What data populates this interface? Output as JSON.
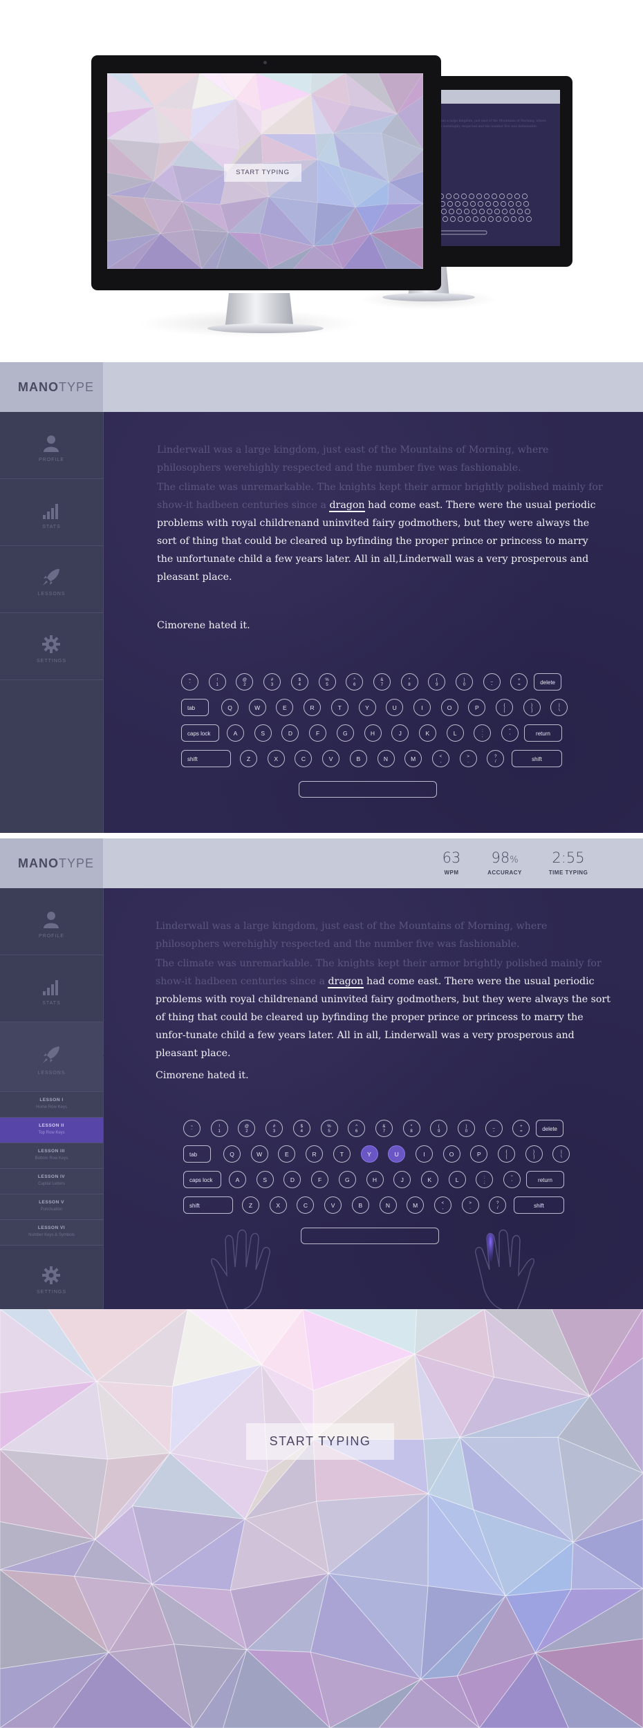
{
  "mockup": {
    "start_button_label": "START TYPING"
  },
  "app": {
    "logo_bold": "MANO",
    "logo_light": "TYPE",
    "sidebar": {
      "profile": "PROFILE",
      "stats": "STATS",
      "lessons": "LESSONS",
      "settings": "SETTINGS"
    },
    "text": {
      "p1": "Linderwall was a large kingdom, just east of the Mountains of Morning, where philosophers werehighly respected and the number five was fashionable.",
      "p2_typed": "The climate was unremarkable. The knights kept their armor brightly polished mainly for show-it hadbeen centuries since a ",
      "p2_current_word": "dragon",
      "p2_rest_v1": " had come east. There were the usual periodic problems with royal childrenand uninvited fairy godmothers, but they were always the sort of thing that could be cleared up byfinding the proper prince or princess to marry the unfortunate child a few years later. All in all,Linderwall was a very prosperous and pleasant place.",
      "p2_rest_v2": " had come east. There were the usual periodic problems with royal childrenand uninvited fairy godmothers, but they were always the sort of thing that could be cleared up byfinding the proper prince or princess to marry the unfor-tunate child a few years later. All in all, Linderwall was a very prosperous and pleasant place.",
      "p3": "Cimorene hated it."
    },
    "keyboard": {
      "row1": [
        {
          "top": "~",
          "bot": "`"
        },
        {
          "top": "!",
          "bot": "1"
        },
        {
          "top": "@",
          "bot": "2"
        },
        {
          "top": "#",
          "bot": "3"
        },
        {
          "top": "$",
          "bot": "4"
        },
        {
          "top": "%",
          "bot": "5"
        },
        {
          "top": "^",
          "bot": "6"
        },
        {
          "top": "&",
          "bot": "7"
        },
        {
          "top": "*",
          "bot": "8"
        },
        {
          "top": "(",
          "bot": "9"
        },
        {
          "top": ")",
          "bot": "0"
        },
        {
          "top": "_",
          "bot": "-"
        },
        {
          "top": "+",
          "bot": "="
        }
      ],
      "delete": "delete",
      "tab": "tab",
      "row2": [
        "Q",
        "W",
        "E",
        "R",
        "T",
        "Y",
        "U",
        "I",
        "O",
        "P"
      ],
      "row2_sym": [
        {
          "top": "{",
          "bot": "["
        },
        {
          "top": "}",
          "bot": "]"
        },
        {
          "top": "|",
          "bot": "\\"
        }
      ],
      "caps": "caps lock",
      "row3": [
        "A",
        "S",
        "D",
        "F",
        "G",
        "H",
        "J",
        "K",
        "L"
      ],
      "row3_sym": [
        {
          "top": ":",
          "bot": ";"
        },
        {
          "top": "\"",
          "bot": "'"
        }
      ],
      "return": "return",
      "shift_left": "shift",
      "row4": [
        "Z",
        "X",
        "C",
        "V",
        "B",
        "N",
        "M"
      ],
      "row4_sym": [
        {
          "top": "<",
          "bot": ","
        },
        {
          "top": ">",
          "bot": "."
        },
        {
          "top": "?",
          "bot": "/"
        }
      ],
      "shift_right": "shift",
      "active_keys": [
        "Y",
        "U"
      ]
    },
    "stats": [
      {
        "value": "63",
        "unit": "",
        "label": "WPM"
      },
      {
        "value": "98",
        "unit": "%",
        "label": "ACCURACY"
      },
      {
        "value": "2:55",
        "unit": "",
        "label": "TIME TYPING"
      }
    ],
    "lessons": [
      {
        "title": "LESSON I",
        "sub": "Home Row Keys"
      },
      {
        "title": "LESSON II",
        "sub": "Top Row Keys"
      },
      {
        "title": "LESSON III",
        "sub": "Bottom Row Keys"
      },
      {
        "title": "LESSON IV",
        "sub": "Capital Letters"
      },
      {
        "title": "LESSON V",
        "sub": "Punctuation"
      },
      {
        "title": "LESSON VI",
        "sub": "Number Keys & Symbols"
      }
    ],
    "active_lesson_index": 1
  },
  "start_screen": {
    "button_label": "START TYPING"
  },
  "colors": {
    "header": "#c7cad8",
    "sidebar": "#3c3d56",
    "content": "#2d2850",
    "active_key": "#6a56c4",
    "active_lesson": "#5845a8"
  }
}
